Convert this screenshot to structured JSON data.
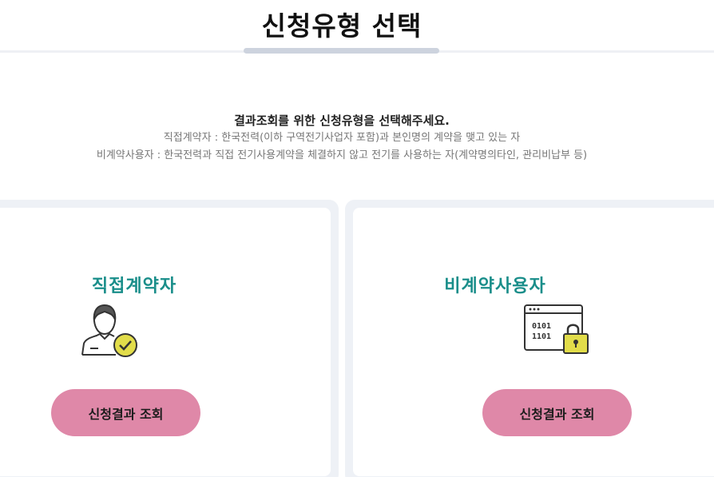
{
  "page": {
    "title": "신청유형 선택"
  },
  "intro": {
    "main": "결과조회를 위한 신청유형을 선택해주세요.",
    "line1": "직접계약자 : 한국전력(이하 구역전기사업자 포함)과 본인명의 계약을 맺고 있는 자",
    "line2": "비계약사용자 : 한국전력과 직접 전기사용계약을 체결하지 않고 전기를 사용하는 자(계약명의타인, 관리비납부 등)"
  },
  "cards": [
    {
      "title": "직접계약자",
      "icon": "user-check-icon",
      "button_label": "신청결과 조회"
    },
    {
      "title": "비계약사용자",
      "icon": "locked-data-icon",
      "button_label": "신청결과 조회"
    }
  ],
  "colors": {
    "accent_teal": "#1a8e8a",
    "button_pink": "#df88a8",
    "icon_yellow": "#e2dd4a",
    "frame_bg": "#eef1f6"
  }
}
